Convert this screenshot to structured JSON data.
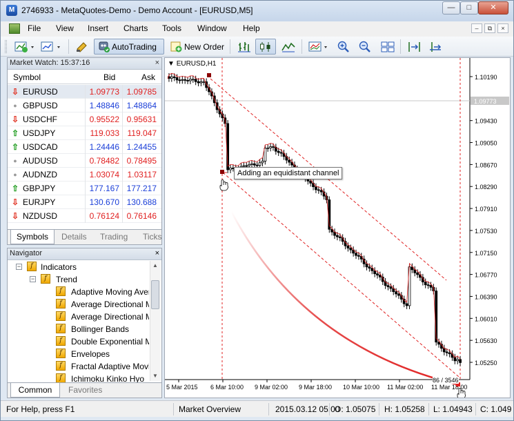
{
  "window": {
    "title": "2746933 - MetaQuotes-Demo - Demo Account - [EURUSD,M5]",
    "minimize": "—",
    "maximize": "□",
    "close": "✕"
  },
  "menu": [
    "File",
    "View",
    "Insert",
    "Charts",
    "Tools",
    "Window",
    "Help"
  ],
  "toolbar": {
    "autotrading": "AutoTrading",
    "new_order": "New Order"
  },
  "market_watch": {
    "title": "Market Watch: 15:37:16",
    "close": "×",
    "columns": {
      "symbol": "Symbol",
      "bid": "Bid",
      "ask": "Ask"
    },
    "rows": [
      {
        "symbol": "EURUSD",
        "bid": "1.09773",
        "ask": "1.09785",
        "dir": "down",
        "color": "#e02020"
      },
      {
        "symbol": "GBPUSD",
        "bid": "1.48846",
        "ask": "1.48864",
        "dir": "none",
        "color": "#1a3ed8"
      },
      {
        "symbol": "USDCHF",
        "bid": "0.95522",
        "ask": "0.95631",
        "dir": "down",
        "color": "#e02020"
      },
      {
        "symbol": "USDJPY",
        "bid": "119.033",
        "ask": "119.047",
        "dir": "up",
        "color": "#e02020"
      },
      {
        "symbol": "USDCAD",
        "bid": "1.24446",
        "ask": "1.24455",
        "dir": "up",
        "color": "#1a3ed8"
      },
      {
        "symbol": "AUDUSD",
        "bid": "0.78482",
        "ask": "0.78495",
        "dir": "none",
        "color": "#e02020"
      },
      {
        "symbol": "AUDNZD",
        "bid": "1.03074",
        "ask": "1.03117",
        "dir": "none",
        "color": "#e02020"
      },
      {
        "symbol": "GBPJPY",
        "bid": "177.167",
        "ask": "177.217",
        "dir": "up",
        "color": "#1a3ed8"
      },
      {
        "symbol": "EURJPY",
        "bid": "130.670",
        "ask": "130.688",
        "dir": "down",
        "color": "#1a3ed8"
      },
      {
        "symbol": "NZDUSD",
        "bid": "0.76124",
        "ask": "0.76146",
        "dir": "down",
        "color": "#e02020"
      }
    ],
    "tabs": [
      "Symbols",
      "Details",
      "Trading",
      "Ticks"
    ]
  },
  "navigator": {
    "title": "Navigator",
    "close": "×",
    "root": "Indicators",
    "group": "Trend",
    "items": [
      "Adaptive Moving Average",
      "Average Directional Movement Index",
      "Average Directional Movement Index Wilder",
      "Bollinger Bands",
      "Double Exponential Moving Average",
      "Envelopes",
      "Fractal Adaptive Moving Average",
      "Ichimoku Kinko Hyo"
    ],
    "tabs": [
      "Common",
      "Favorites"
    ]
  },
  "chart": {
    "label": "EURUSD,H1",
    "tooltip": "Adding an equidistant channel",
    "price_labels": [
      "1.10190",
      "1.09773",
      "1.09430",
      "1.09050",
      "1.08670",
      "1.08290",
      "1.07910",
      "1.07530",
      "1.07150",
      "1.06770",
      "1.06390",
      "1.06010",
      "1.05630",
      "1.05250"
    ],
    "time_labels": [
      "5 Mar 2015",
      "6 Mar 10:00",
      "9 Mar 02:00",
      "9 Mar 18:00",
      "10 Mar 10:00",
      "11 Mar 02:00",
      "11 Mar 18:00"
    ],
    "cursor_readout": "86 / 3546",
    "colors": {
      "bull": "#000000",
      "bear": "#000000",
      "channel": "#e02020",
      "current": "#c8c8c8"
    }
  },
  "status": {
    "help": "For Help, press F1",
    "profile": "Market Overview",
    "datetime": "2015.03.12 05:00",
    "open": "O: 1.05075",
    "high": "H: 1.05258",
    "low": "L: 1.04943",
    "close": "C: 1.049"
  }
}
